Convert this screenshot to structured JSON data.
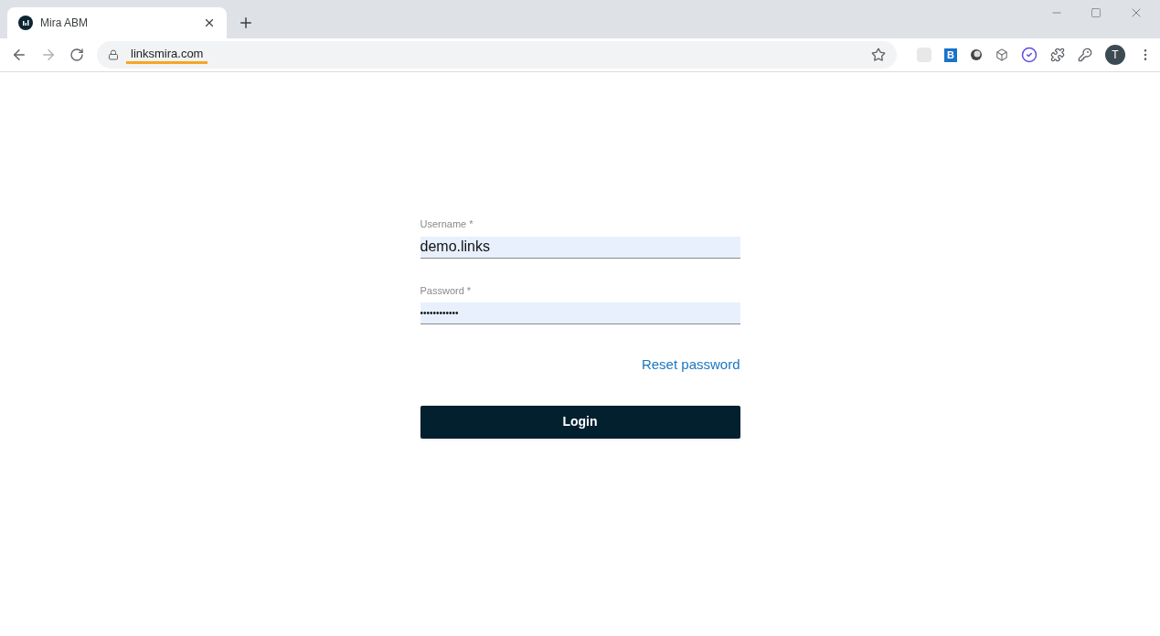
{
  "browser": {
    "tab": {
      "title": "Mira ABM",
      "selected": true
    },
    "address": "linksmira.com",
    "extension_badge": "B",
    "profile_initial": "T"
  },
  "login": {
    "fields": [
      {
        "label": "Username *",
        "value": "demo.links",
        "kind": "text"
      },
      {
        "label": "Password *",
        "value": "••••••••••••",
        "kind": "password"
      }
    ],
    "reset_link": "Reset password",
    "submit": "Login"
  }
}
